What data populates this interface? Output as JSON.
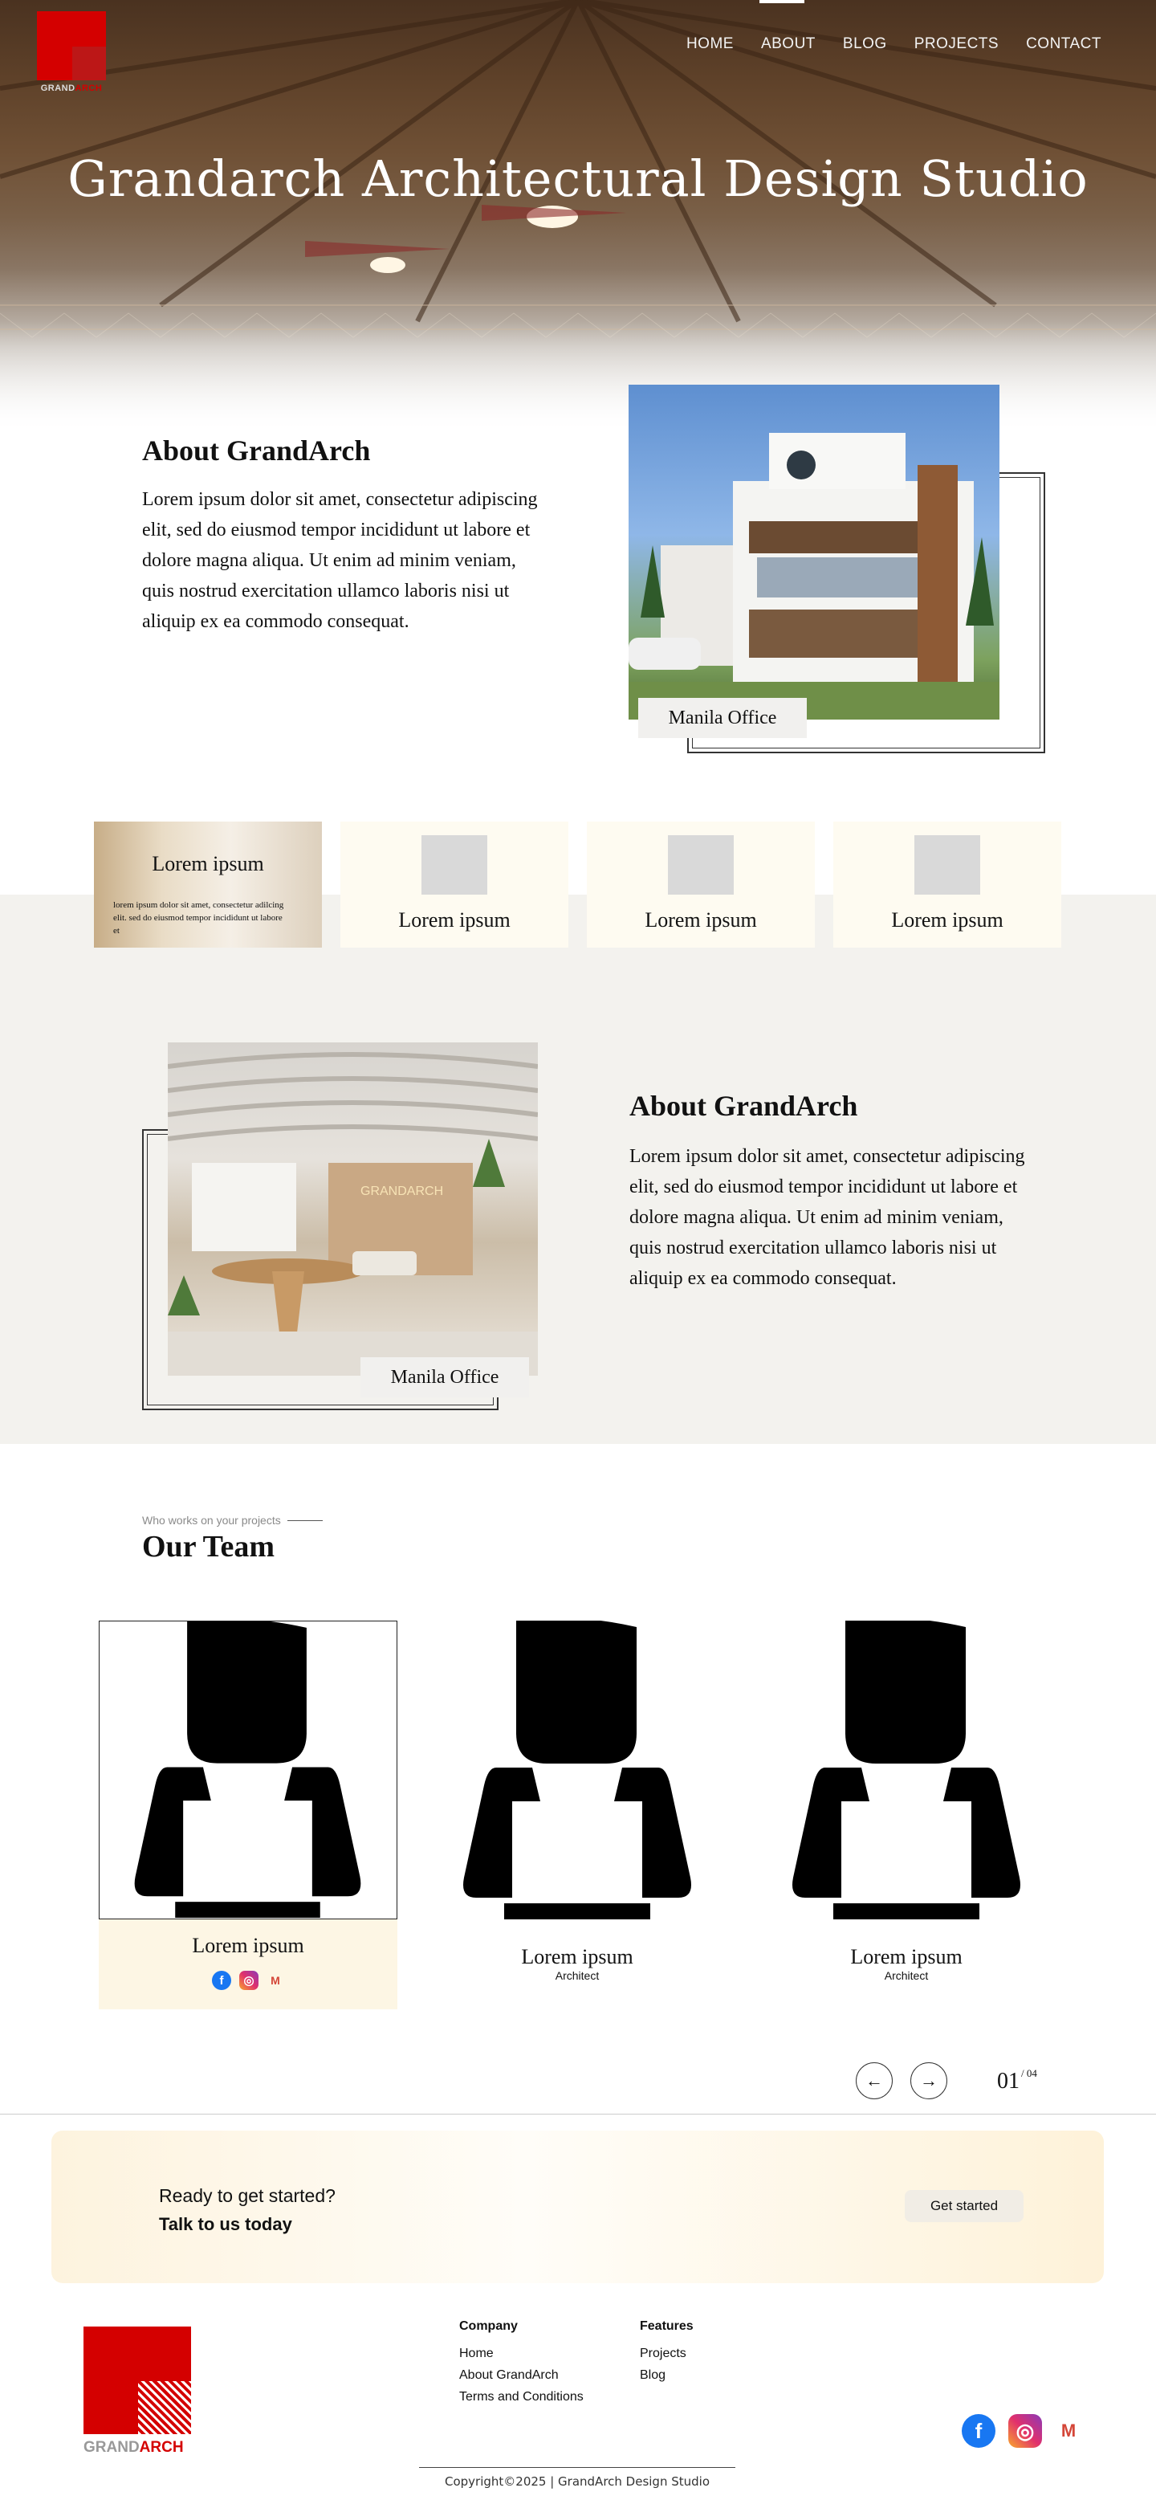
{
  "brand": {
    "name_grey": "GRAND",
    "name_red": "ARCH"
  },
  "nav": {
    "items": [
      "HOME",
      "ABOUT",
      "BLOG",
      "PROJECTS",
      "CONTACT"
    ]
  },
  "hero": {
    "title": "Grandarch Architectural Design Studio"
  },
  "about1": {
    "title": "About GrandArch",
    "text": "Lorem ipsum dolor sit amet, consectetur adipiscing elit, sed do eiusmod tempor incididunt ut labore et dolore magna aliqua. Ut enim ad minim veniam, quis nostrud exercitation ullamco laboris nisi ut aliquip ex ea commodo consequat.",
    "caption": "Manila Office"
  },
  "cards": [
    {
      "title": "Lorem ipsum",
      "text": "lorem ipsum dolor sit amet, consectetur adilcing elit. sed do eiusmod tempor incididunt ut labore et"
    },
    {
      "title": "Lorem ipsum"
    },
    {
      "title": "Lorem ipsum"
    },
    {
      "title": "Lorem ipsum"
    }
  ],
  "about2": {
    "title": "About GrandArch",
    "text": "Lorem ipsum dolor sit amet, consectetur adipiscing elit, sed do eiusmod tempor incididunt ut labore et dolore magna aliqua. Ut enim ad minim veniam, quis nostrud exercitation ullamco laboris nisi ut aliquip ex ea commodo consequat.",
    "caption": "Manila Office",
    "sign": "GRANDARCH"
  },
  "team": {
    "kicker": "Who works on your projects",
    "title": "Our Team",
    "members": [
      {
        "name": "Lorem ipsum",
        "role": ""
      },
      {
        "name": "Lorem ipsum",
        "role": "Architect"
      },
      {
        "name": "Lorem ipsum",
        "role": "Architect"
      }
    ],
    "pager": {
      "prev": "←",
      "next": "→",
      "current": "01",
      "total": "/ 04"
    }
  },
  "cta": {
    "line1": "Ready to get started?",
    "line2": "Talk to us today",
    "button": "Get started"
  },
  "footer": {
    "company": {
      "heading": "Company",
      "links": [
        "Home",
        "About GrandArch",
        "Terms and Conditions"
      ]
    },
    "features": {
      "heading": "Features",
      "links": [
        "Projects",
        "Blog"
      ]
    },
    "copyright": "Copyright©2025 | GrandArch Design Studio"
  },
  "icons": {
    "facebook": "facebook-icon",
    "instagram": "instagram-icon",
    "gmail": "gmail-icon"
  },
  "colors": {
    "brand_red": "#d40000",
    "cream": "#fefbf1",
    "band": "#f3f2ee"
  }
}
